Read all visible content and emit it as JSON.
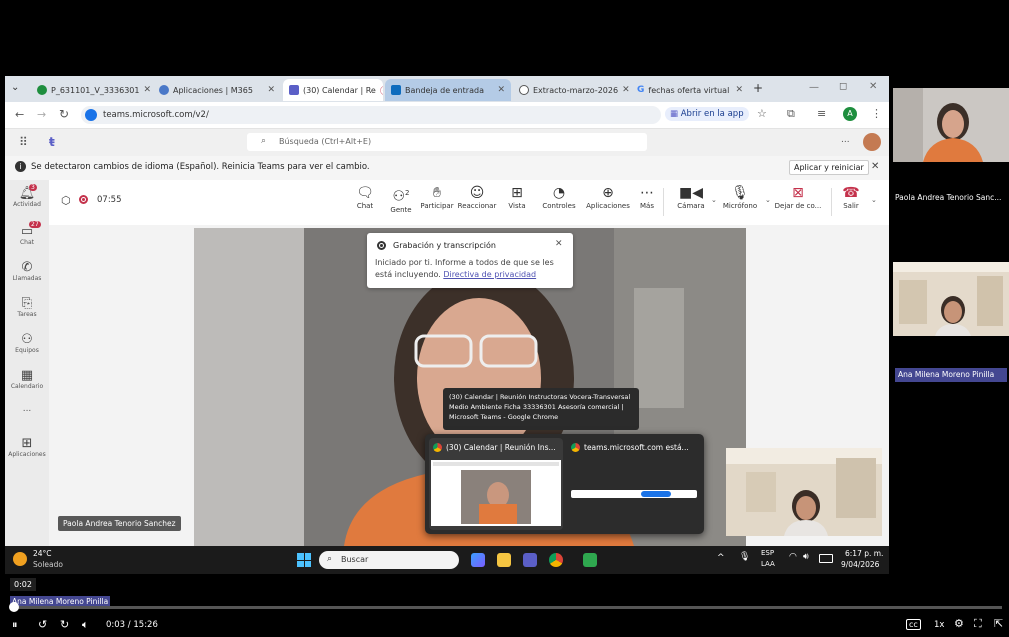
{
  "browser": {
    "tabs": [
      {
        "label": "P_631101_V_3336301",
        "color": "#1e8e3e"
      },
      {
        "label": "Aplicaciones | M365",
        "color": "#4a78c8"
      },
      {
        "label": "(30) Calendar | Re",
        "color": "#5b5fc7"
      },
      {
        "label": "Bandeja de entrada",
        "color": "#0f6cbd"
      },
      {
        "label": "Extracto-marzo-2026",
        "color": "#555555"
      },
      {
        "label": "fechas oferta virtual",
        "color": "#4285f4"
      }
    ],
    "new_tab": "+",
    "url": "teams.microsoft.com/v2/",
    "open_app": "Abrir en la app",
    "profile_letter": "A"
  },
  "teams": {
    "search_placeholder": "Búsqueda (Ctrl+Alt+E)",
    "more": "...",
    "notice": "Se detectaron cambios de idioma (Español). Reinicia Teams para ver el cambio.",
    "apply_button": "Aplicar y reiniciar",
    "rail": [
      {
        "label": "Actividad",
        "icon": "bell-icon",
        "badge": "3"
      },
      {
        "label": "Chat",
        "icon": "chat-icon",
        "badge": "27"
      },
      {
        "label": "Llamadas",
        "icon": "phone-icon",
        "badge": ""
      },
      {
        "label": "Tareas",
        "icon": "tasks-icon",
        "badge": ""
      },
      {
        "label": "Equipos",
        "icon": "teams-icon",
        "badge": ""
      },
      {
        "label": "Calendario",
        "icon": "calendar-icon",
        "badge": ""
      },
      {
        "label": "...",
        "icon": "more-icon",
        "badge": ""
      },
      {
        "label": "Aplicaciones",
        "icon": "apps-icon",
        "badge": ""
      }
    ],
    "meeting_timer": "07:55",
    "controls": [
      {
        "label": "Chat",
        "glyph": "💬"
      },
      {
        "label": "Gente",
        "glyph": "👥",
        "count": "2"
      },
      {
        "label": "Participar",
        "glyph": "✋"
      },
      {
        "label": "Reaccionar",
        "glyph": "☺"
      },
      {
        "label": "Vista",
        "glyph": "⊞"
      },
      {
        "label": "Controles",
        "glyph": "⚙"
      },
      {
        "label": "Aplicaciones",
        "glyph": "⊕"
      },
      {
        "label": "Más",
        "glyph": "⋯"
      }
    ],
    "camera_label": "Cámara",
    "mic_label": "Micrófono",
    "share_label": "Dejar de co...",
    "leave_label": "Salir",
    "recording_title": "Grabación y transcripción",
    "recording_text": "Iniciado por ti. Informe a todos de que se les está incluyendo.",
    "privacy_link": "Directiva de privacidad",
    "video_name": "Paola Andrea Tenorio Sanchez"
  },
  "tooltip": {
    "text": "(30) Calendar | Reunión Instructoras Vocera-Transversal Medio Ambiente Ficha 33336301 Asesoría comercial | Microsoft Teams - Google Chrome"
  },
  "preview": {
    "tab1": "(30) Calendar | Reunión Ins...",
    "tab2": "teams.microsoft.com está..."
  },
  "taskbar": {
    "temp": "24°C",
    "weather": "Soleado",
    "search": "Buscar",
    "lang1": "ESP",
    "lang2": "LAA",
    "time": "6:17 p. m.",
    "date": "9/04/2026"
  },
  "participants": [
    {
      "name": "Paola Andrea Tenorio Sanc..."
    },
    {
      "name": "Ana Milena Moreno Pinilla"
    }
  ],
  "player": {
    "hover_time": "0:02",
    "hover_name": "Ana Milena Moreno Pinilla",
    "current": "0:03",
    "total": "15:26",
    "speed": "1x",
    "progress": 0.003
  },
  "colors": {
    "teams_purple": "#5b5fc7",
    "record_red": "#c4314b",
    "leave_red": "#c4314b",
    "name_label_bg": "#444791"
  }
}
